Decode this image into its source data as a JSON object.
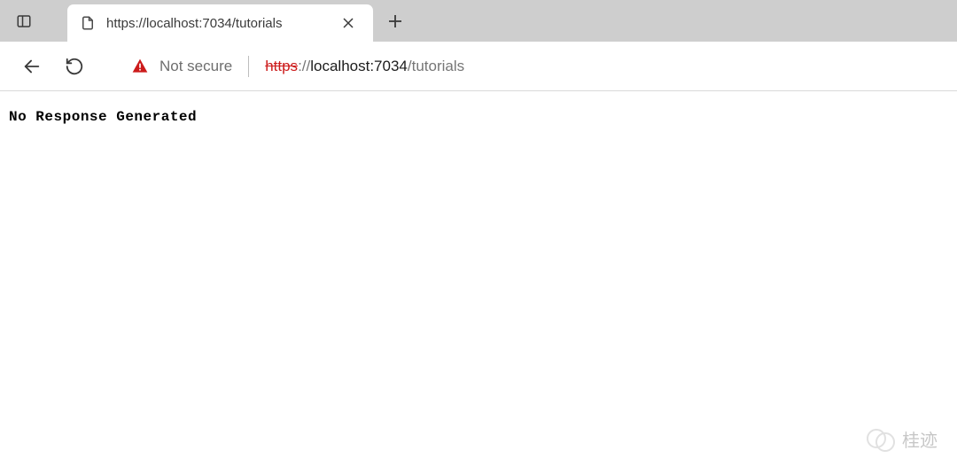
{
  "tab": {
    "title": "https://localhost:7034/tutorials"
  },
  "address_bar": {
    "security_label": "Not secure",
    "url_proto": "https",
    "url_proto_sep": "://",
    "url_host": "localhost:7034",
    "url_path": "/tutorials"
  },
  "page": {
    "body_text": "No Response Generated"
  },
  "watermark": {
    "text": "桂迹"
  }
}
